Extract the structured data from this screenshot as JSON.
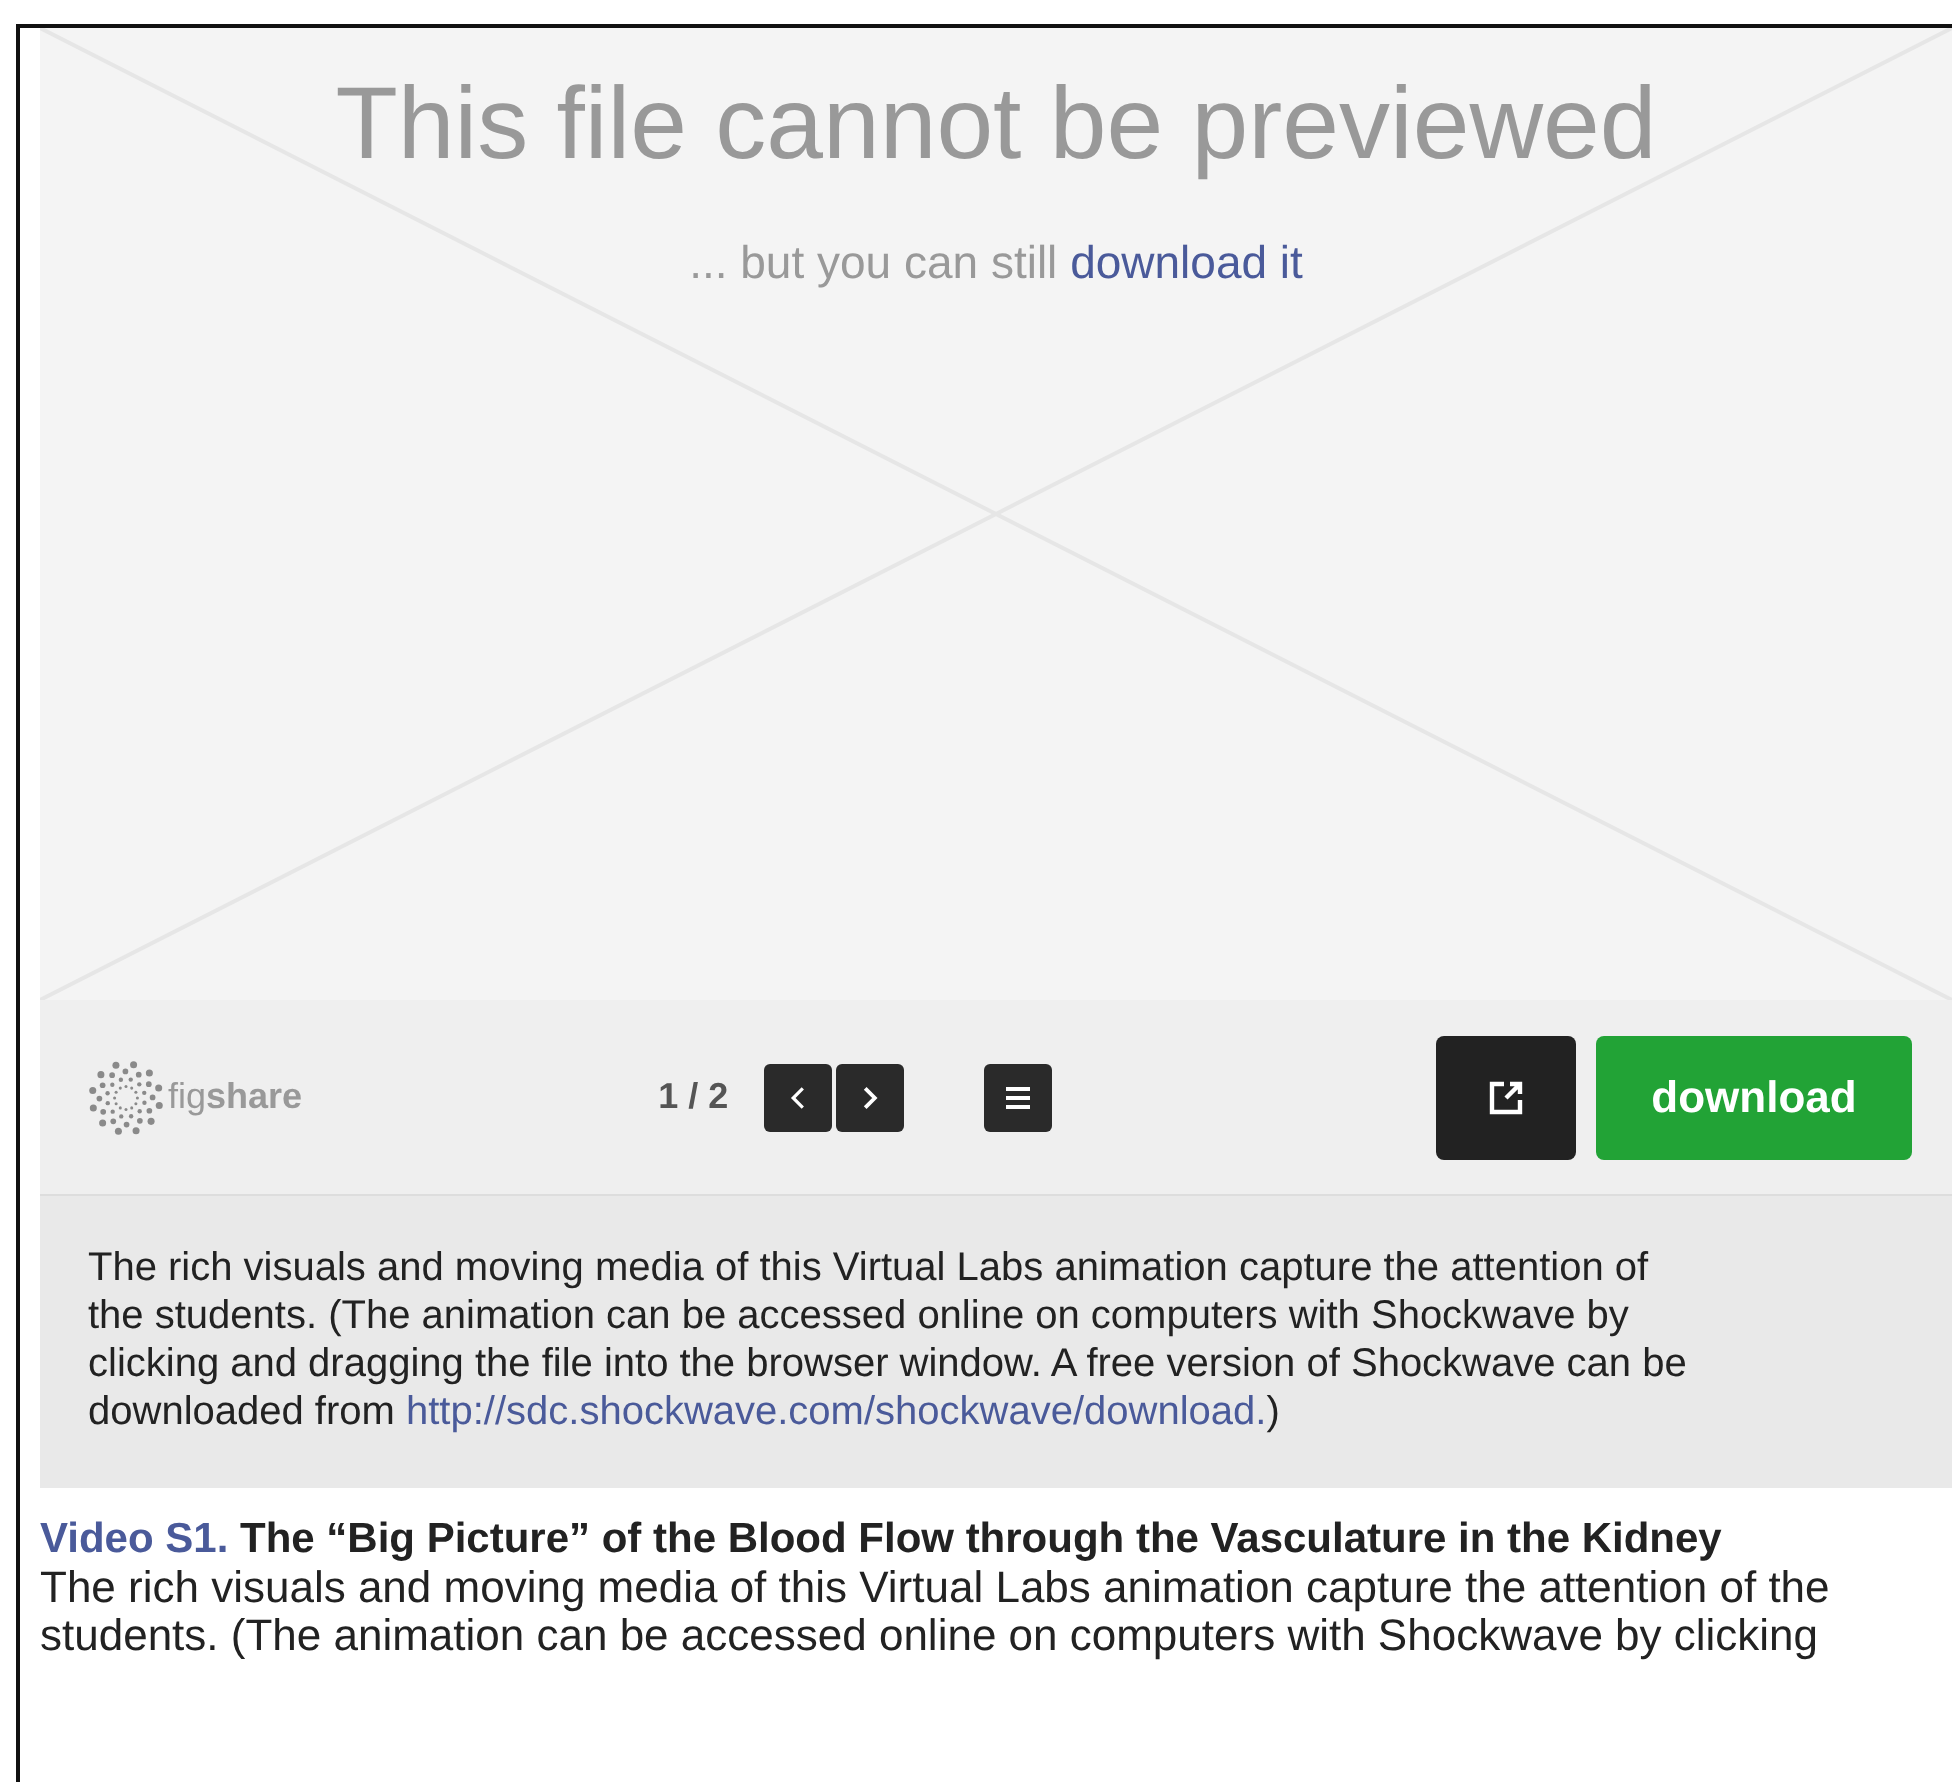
{
  "preview": {
    "title": "This file cannot be previewed",
    "subtitle": "... but you can still",
    "subtitle_link": "download it"
  },
  "toolbar": {
    "brand": "fig**share**",
    "page": "1 / 2",
    "download": "download"
  },
  "description": {
    "lines": [
      "The rich visuals and moving media of this Virtual Labs animation capture the attention of",
      "the students. (The animation can be accessed online on computers with Shockwave by",
      "clicking and dragging the file into the browser window. A free version of Shockwave can be"
    ],
    "last_prefix": "downloaded from ",
    "link": "http://sdc.shockwave.com/shockwave/download.",
    "suffix": ")"
  },
  "caption": {
    "label": "Video S1.",
    "title": "The “Big Picture” of the Blood Flow through the Vasculature in the Kidney",
    "lines": [
      "The rich visuals and moving media of this Virtual Labs animation capture the attention of the",
      "students. (The animation can be accessed online on computers with Shockwave by clicking"
    ]
  }
}
